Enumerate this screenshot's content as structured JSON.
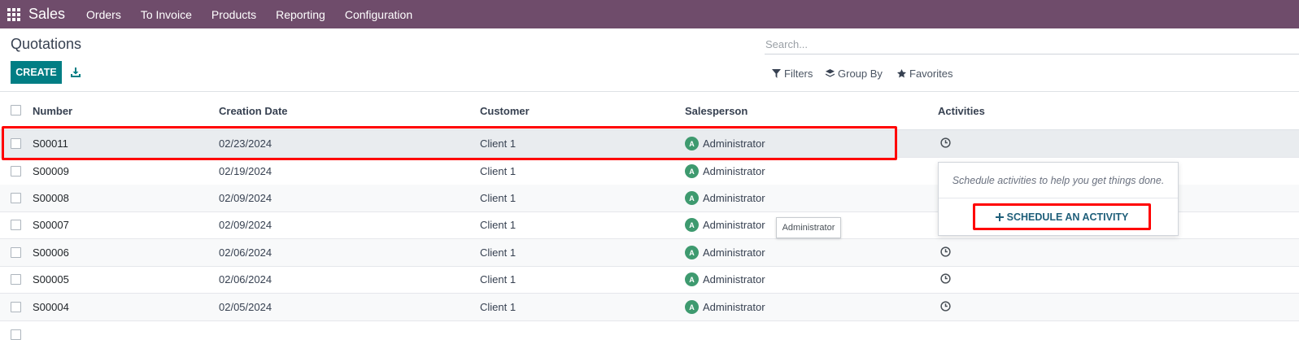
{
  "navbar": {
    "app_name": "Sales",
    "menu": [
      "Orders",
      "To Invoice",
      "Products",
      "Reporting",
      "Configuration"
    ]
  },
  "page": {
    "title": "Quotations",
    "create_label": "CREATE",
    "search_placeholder": "Search...",
    "filters_label": "Filters",
    "groupby_label": "Group By",
    "favorites_label": "Favorites"
  },
  "table": {
    "headers": {
      "number": "Number",
      "date": "Creation Date",
      "customer": "Customer",
      "salesperson": "Salesperson",
      "activities": "Activities"
    },
    "rows": [
      {
        "number": "S00011",
        "date": "02/23/2024",
        "customer": "Client 1",
        "salesperson": "Administrator",
        "avatar": "A"
      },
      {
        "number": "S00009",
        "date": "02/19/2024",
        "customer": "Client 1",
        "salesperson": "Administrator",
        "avatar": "A"
      },
      {
        "number": "S00008",
        "date": "02/09/2024",
        "customer": "Client 1",
        "salesperson": "Administrator",
        "avatar": "A"
      },
      {
        "number": "S00007",
        "date": "02/09/2024",
        "customer": "Client 1",
        "salesperson": "Administrator",
        "avatar": "A"
      },
      {
        "number": "S00006",
        "date": "02/06/2024",
        "customer": "Client 1",
        "salesperson": "Administrator",
        "avatar": "A"
      },
      {
        "number": "S00005",
        "date": "02/06/2024",
        "customer": "Client 1",
        "salesperson": "Administrator",
        "avatar": "A"
      },
      {
        "number": "S00004",
        "date": "02/05/2024",
        "customer": "Client 1",
        "salesperson": "Administrator",
        "avatar": "A"
      }
    ]
  },
  "tooltip": "Administrator",
  "activity_popover": {
    "message": "Schedule activities to help you get things done.",
    "button_label": "SCHEDULE AN ACTIVITY"
  },
  "colors": {
    "navbar": "#6f4c6b",
    "primary": "#017e84",
    "avatar": "#3e9a6f",
    "annotation": "#ff0000"
  }
}
